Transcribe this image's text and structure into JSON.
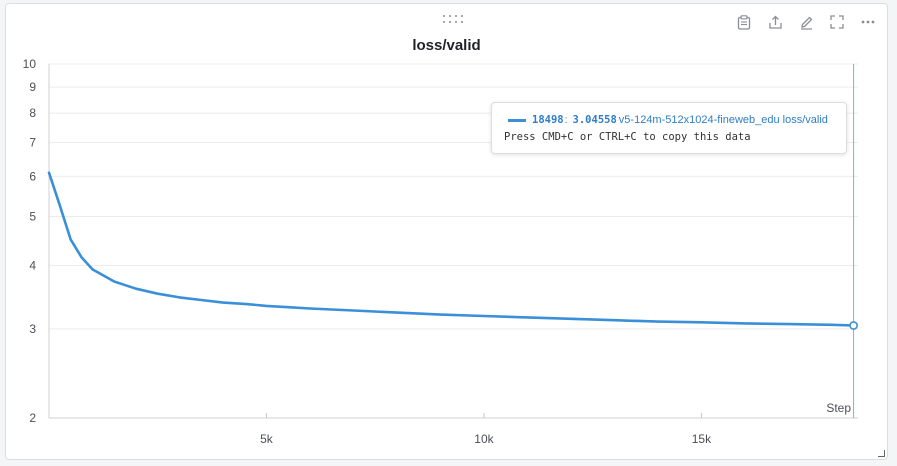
{
  "panel": {
    "title": "loss/valid",
    "toolbar": [
      {
        "icon": "clipboard-icon"
      },
      {
        "icon": "share-icon"
      },
      {
        "icon": "edit-icon"
      },
      {
        "icon": "fullscreen-icon"
      },
      {
        "icon": "more-icon"
      }
    ]
  },
  "tooltip": {
    "step": "18498",
    "value": "3.04558",
    "series_name": "v5-124m-512x1024-fineweb_edu loss/valid",
    "hint": "Press CMD+C or CTRL+C to copy this data"
  },
  "chart_data": {
    "type": "line",
    "title": "loss/valid",
    "xlabel": "Step",
    "ylabel": "",
    "y_scale": "log",
    "xlim": [
      0,
      18600
    ],
    "ylim": [
      2,
      10
    ],
    "x_ticks": [
      5000,
      10000,
      15000
    ],
    "x_tick_labels": [
      "5k",
      "10k",
      "15k"
    ],
    "y_ticks": [
      2,
      3,
      4,
      5,
      6,
      7,
      8,
      9,
      10
    ],
    "y_tick_labels": [
      "2",
      "3",
      "4",
      "5",
      "6",
      "7",
      "8",
      "9",
      "10"
    ],
    "grid": true,
    "accent": "#3b8fd9",
    "hover_step": 18498,
    "series": [
      {
        "name": "v5-124m-512x1024-fineweb_edu loss/valid",
        "color": "#3b8fd9",
        "x": [
          0,
          250,
          500,
          750,
          1000,
          1500,
          2000,
          2500,
          3000,
          3500,
          4000,
          4500,
          5000,
          5500,
          6000,
          7000,
          8000,
          9000,
          10000,
          11000,
          12000,
          13000,
          14000,
          15000,
          16000,
          17000,
          18000,
          18498
        ],
        "y": [
          6.1,
          5.25,
          4.5,
          4.15,
          3.93,
          3.72,
          3.6,
          3.52,
          3.46,
          3.42,
          3.38,
          3.36,
          3.33,
          3.31,
          3.29,
          3.26,
          3.23,
          3.2,
          3.18,
          3.16,
          3.14,
          3.12,
          3.1,
          3.09,
          3.075,
          3.065,
          3.055,
          3.04558
        ]
      }
    ]
  }
}
